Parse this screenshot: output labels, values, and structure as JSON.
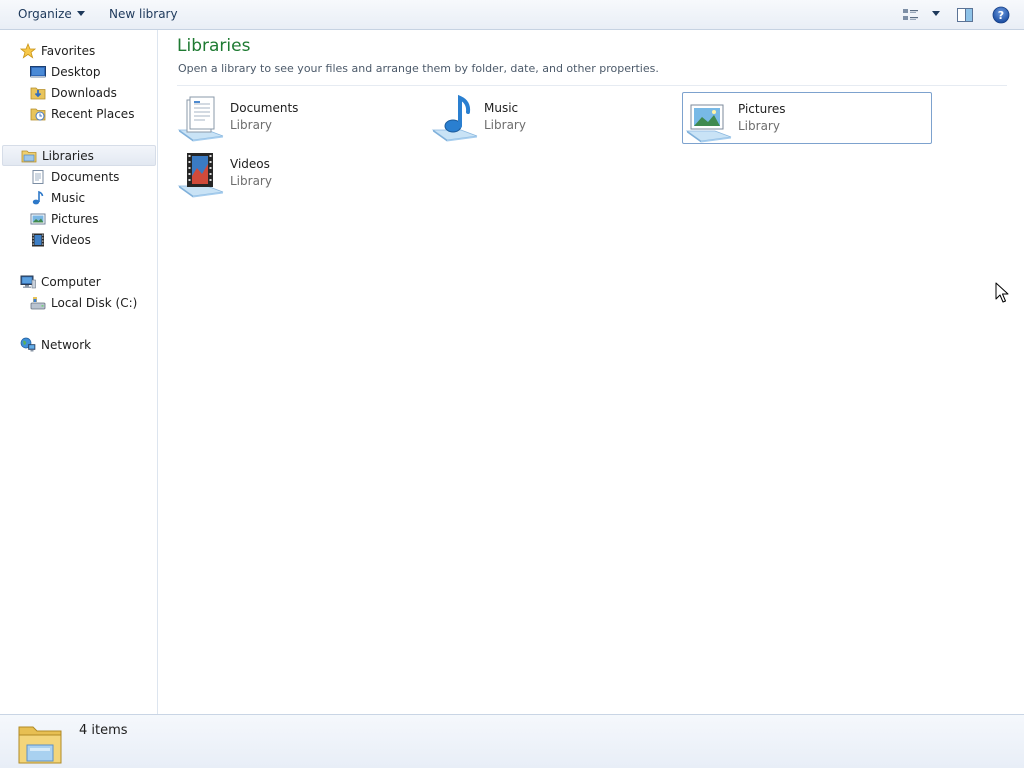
{
  "toolbar": {
    "organize_label": "Organize",
    "new_library_label": "New library",
    "icons": {
      "views": "change-view-icon",
      "views_menu": "chevron-down-icon",
      "preview": "preview-pane-icon",
      "help": "help-icon"
    }
  },
  "nav": {
    "favorites": {
      "label": "Favorites",
      "icon": "star-icon",
      "items": [
        {
          "label": "Desktop",
          "icon": "desktop-icon"
        },
        {
          "label": "Downloads",
          "icon": "downloads-icon"
        },
        {
          "label": "Recent Places",
          "icon": "recent-places-icon"
        }
      ]
    },
    "libraries": {
      "label": "Libraries",
      "icon": "libraries-icon",
      "items": [
        {
          "label": "Documents",
          "icon": "documents-icon"
        },
        {
          "label": "Music",
          "icon": "music-icon"
        },
        {
          "label": "Pictures",
          "icon": "pictures-icon"
        },
        {
          "label": "Videos",
          "icon": "videos-icon"
        }
      ]
    },
    "computer": {
      "label": "Computer",
      "icon": "computer-icon",
      "items": [
        {
          "label": "Local Disk (C:)",
          "icon": "local-disk-icon"
        }
      ]
    },
    "network": {
      "label": "Network",
      "icon": "network-icon"
    }
  },
  "main": {
    "title": "Libraries",
    "subtitle": "Open a library to see your files and arrange them by folder, date, and other properties.",
    "libraries": [
      {
        "name": "Documents",
        "type": "Library",
        "icon": "documents-library-icon"
      },
      {
        "name": "Music",
        "type": "Library",
        "icon": "music-library-icon"
      },
      {
        "name": "Pictures",
        "type": "Library",
        "icon": "pictures-library-icon"
      },
      {
        "name": "Videos",
        "type": "Library",
        "icon": "videos-library-icon"
      }
    ]
  },
  "status": {
    "item_count": "4 items",
    "icon": "libraries-folder-icon"
  },
  "colors": {
    "title_green": "#1e7a32",
    "toolbar_text": "#1e395b",
    "selection_border": "#7da2ce",
    "secondary_text": "#6d6d6d"
  }
}
